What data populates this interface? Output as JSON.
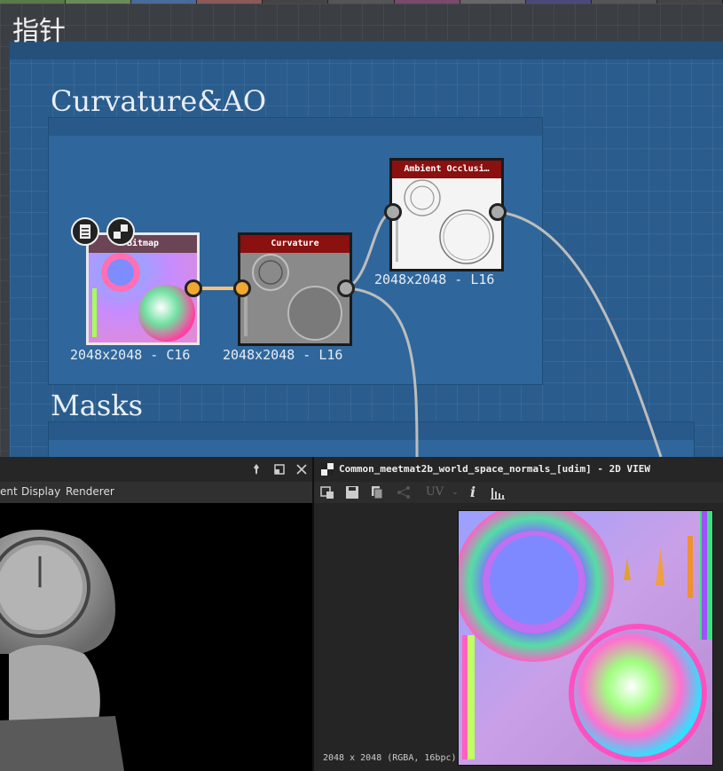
{
  "graph": {
    "root_frame_title": "指针",
    "frames": {
      "curvature_ao": "Curvature&AO",
      "masks": "Masks"
    },
    "nodes": {
      "bitmap": {
        "title": "Bitmap",
        "resolution": "2048x2048 - C16"
      },
      "curvature": {
        "title": "Curvature",
        "resolution": "2048x2048 - L16"
      },
      "ambient_occlusion": {
        "title": "Ambient Occlusi…",
        "resolution": "2048x2048 - L16"
      }
    }
  },
  "left_panel": {
    "menu": {
      "item1": "ent",
      "item2": "Display",
      "item3": "Renderer"
    }
  },
  "view2d": {
    "title": "Common_meetmat2b_world_space_normals_[udim] - 2D VIEW",
    "toolbar": {
      "uv_label": "UV",
      "info_label": "i"
    },
    "status": "2048 x 2048 (RGBA, 16bpc)"
  },
  "colors": {
    "frame_blue": "#2f679c",
    "node_header_red": "#8b1010",
    "port_orange": "#f0a830"
  }
}
